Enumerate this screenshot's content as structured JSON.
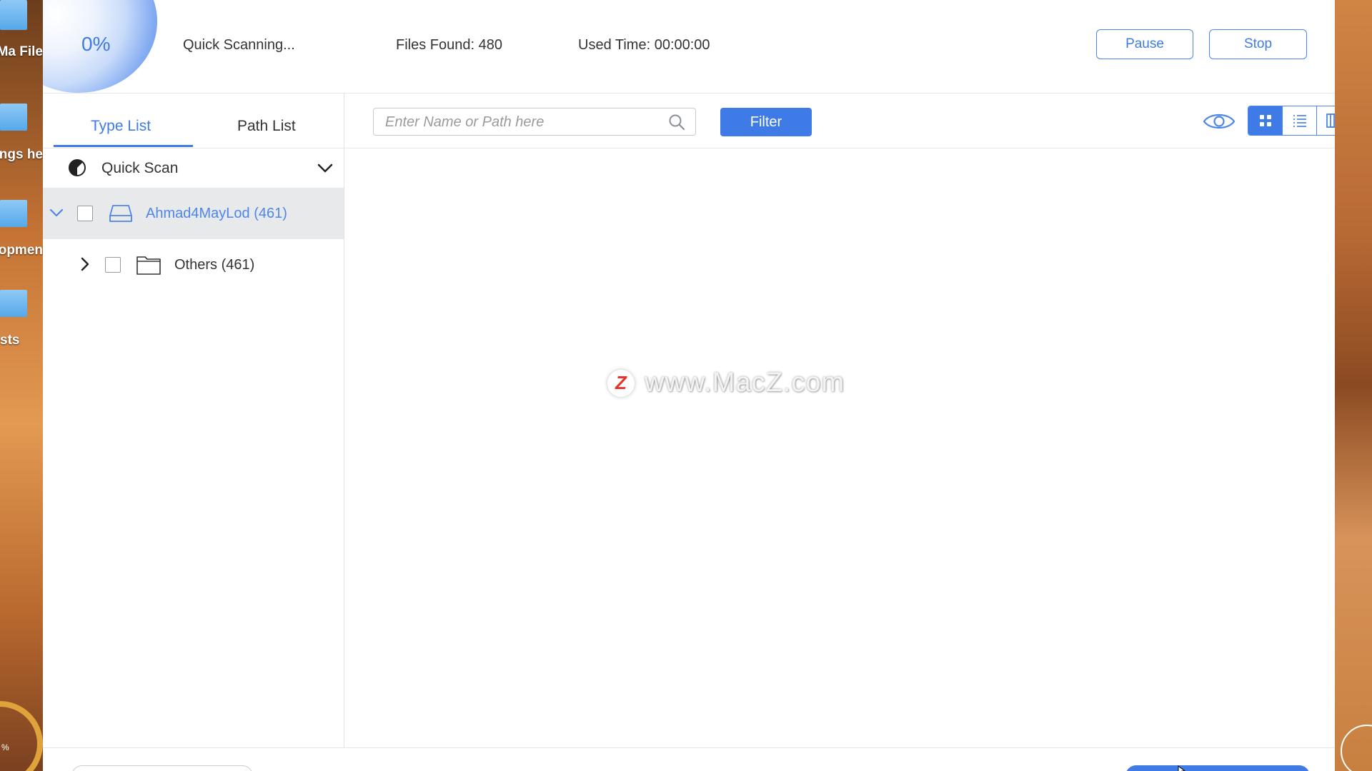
{
  "desktop": {
    "icons": [
      {
        "label": "Ma File"
      },
      {
        "label": "ngs he"
      },
      {
        "label": "opmen"
      },
      {
        "label": "sts"
      }
    ],
    "ring_text": "%"
  },
  "header": {
    "progress": "0%",
    "status": "Quick Scanning...",
    "files_found": "Files Found: 480",
    "used_time": "Used Time: 00:00:00",
    "pause_label": "Pause",
    "stop_label": "Stop"
  },
  "sidebar": {
    "tabs": [
      {
        "label": "Type List",
        "active": true
      },
      {
        "label": "Path List",
        "active": false
      }
    ],
    "scan_mode": "Quick Scan",
    "tree": [
      {
        "label": "Ahmad4MayLod (461)",
        "expanded": true,
        "selected": true,
        "icon": "drive-icon"
      },
      {
        "label": "Others (461)",
        "expanded": false,
        "selected": false,
        "icon": "folder-icon"
      }
    ]
  },
  "toolbar": {
    "search_placeholder": "Enter Name or Path here",
    "search_value": "",
    "filter_label": "Filter",
    "view_modes": [
      "grid-view",
      "list-view",
      "column-view"
    ],
    "active_view": "grid-view"
  },
  "watermark": {
    "logo": "Z",
    "text": "www.MacZ.com"
  },
  "colors": {
    "accent": "#3f7be6",
    "selected_row": "#e8e9eb",
    "text": "#333333"
  }
}
